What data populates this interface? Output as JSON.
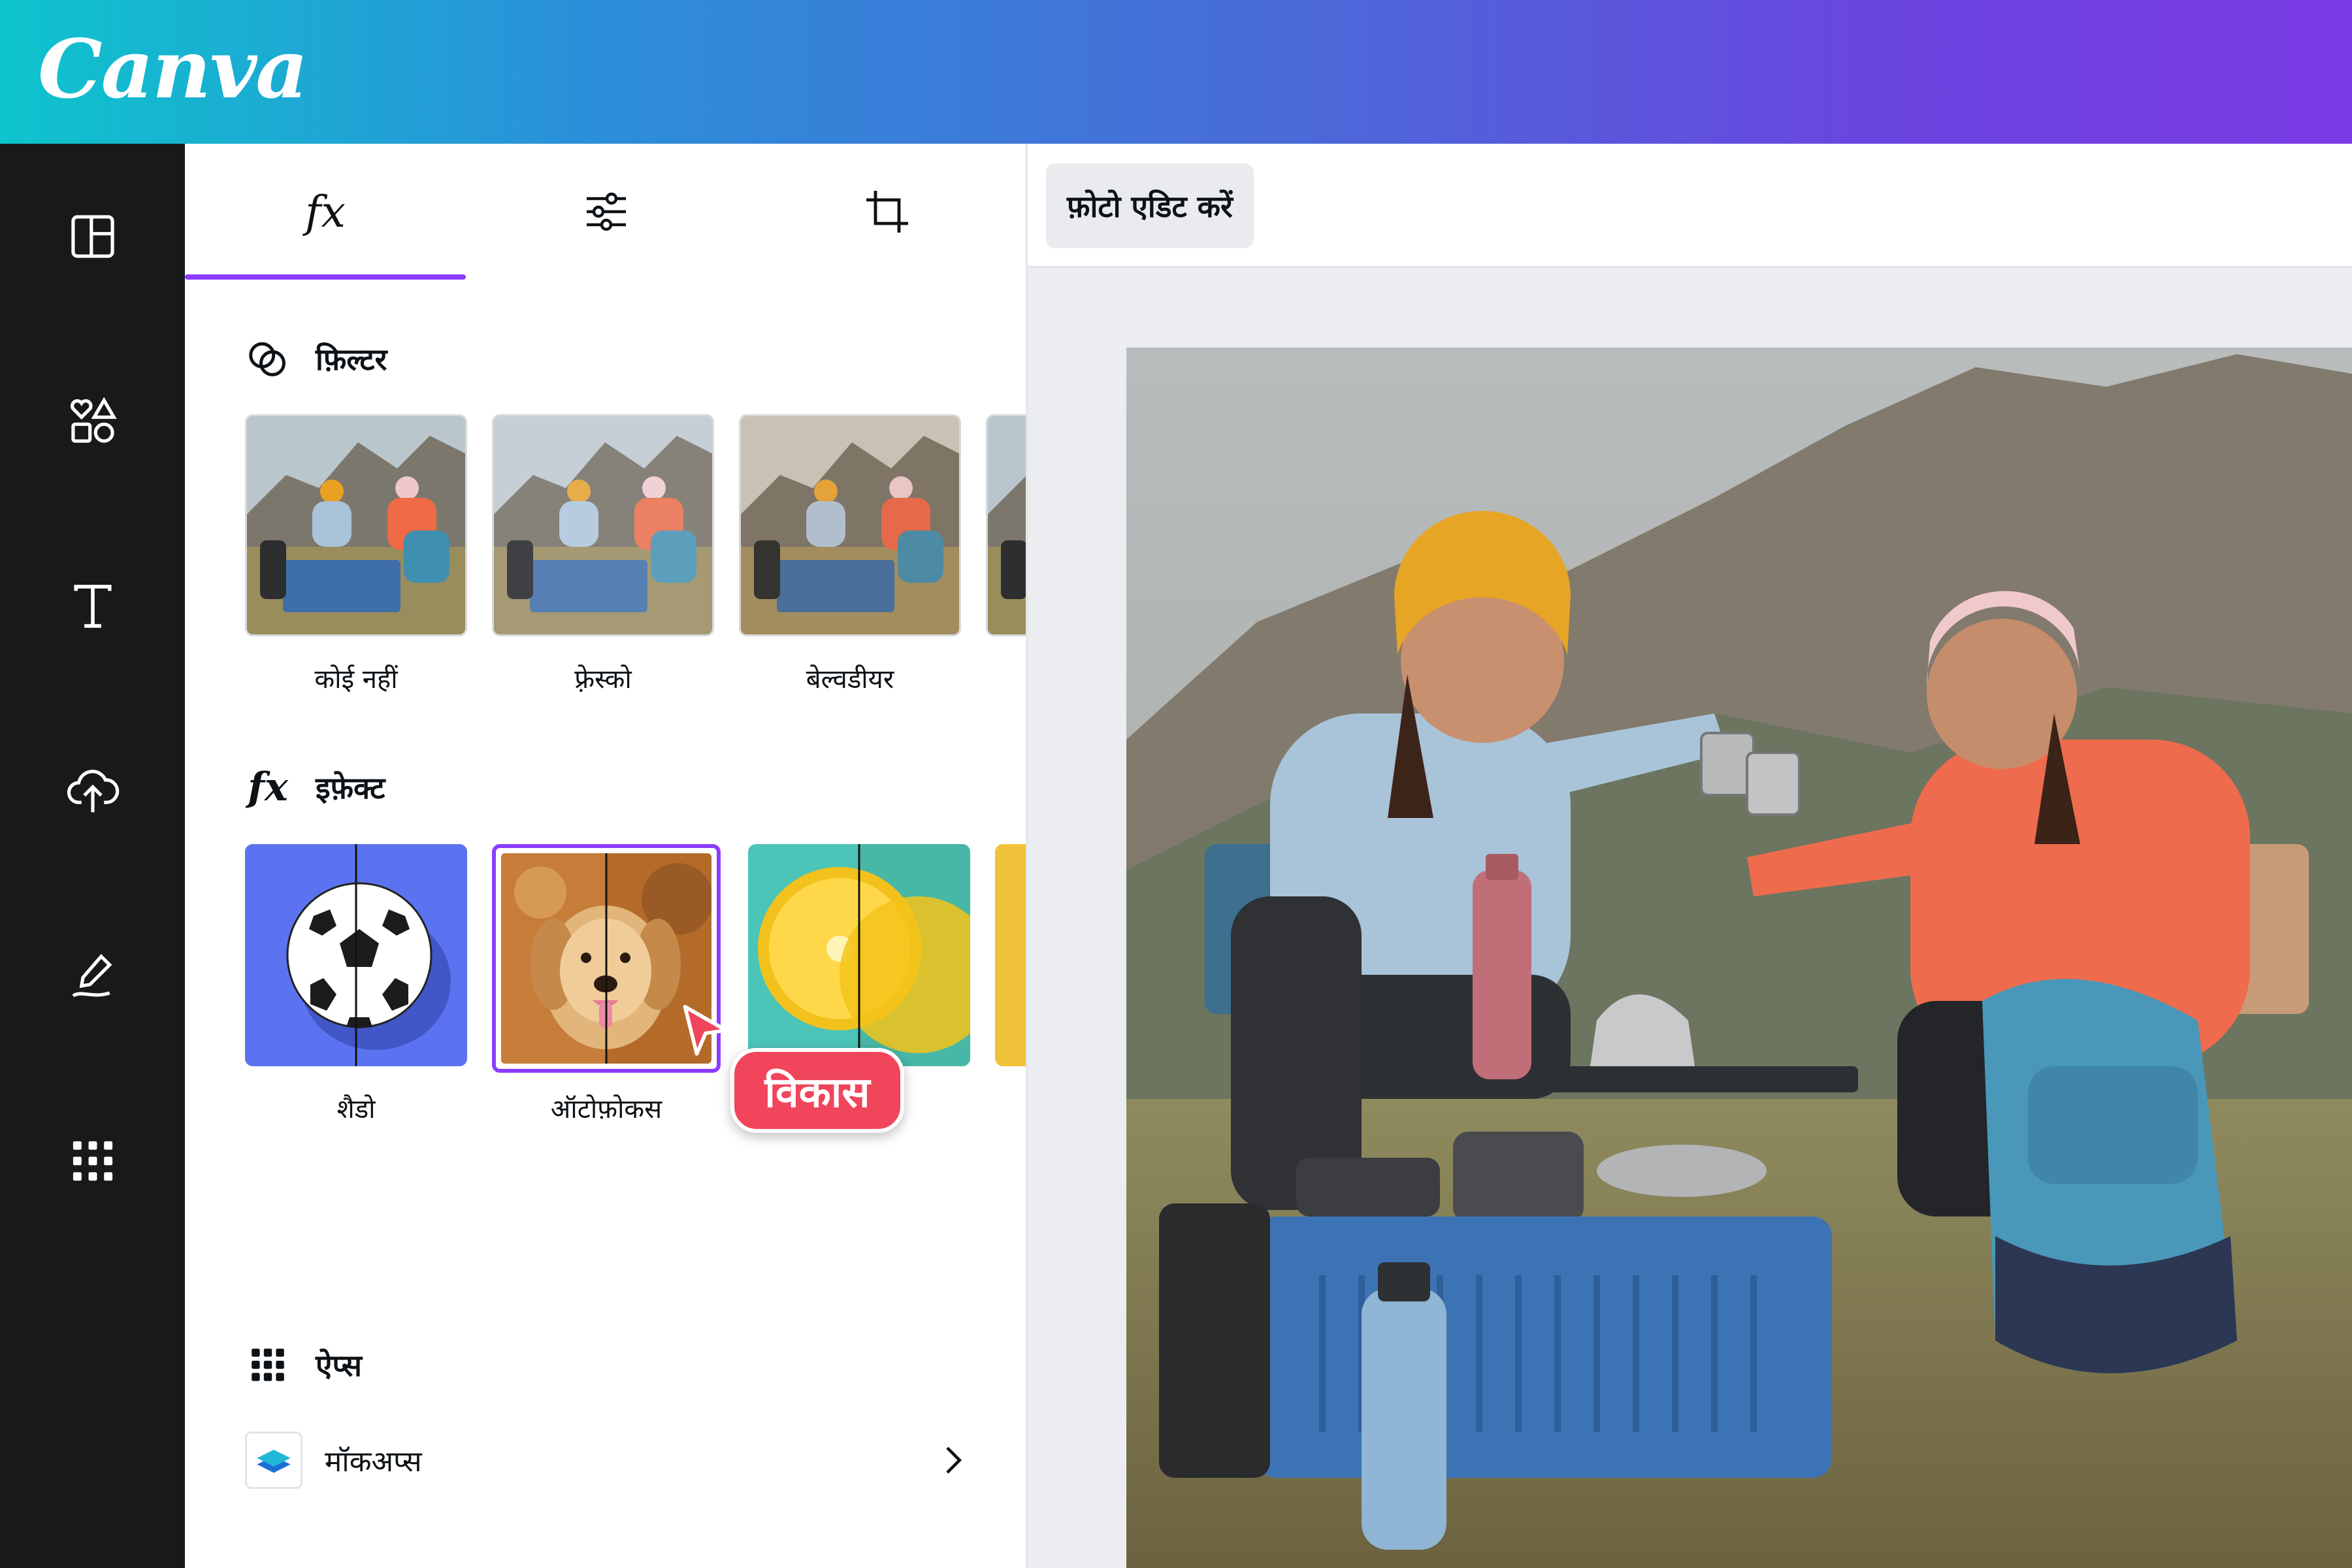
{
  "app": {
    "logo_text": "Canva",
    "brand_color": "#8b3dff",
    "rail_color": "#18191b"
  },
  "rail": {
    "items": [
      {
        "name": "design-icon"
      },
      {
        "name": "elements-icon"
      },
      {
        "name": "text-icon"
      },
      {
        "name": "uploads-icon"
      },
      {
        "name": "draw-icon"
      },
      {
        "name": "apps-icon"
      }
    ]
  },
  "panel": {
    "tabs": [
      {
        "label": "fx",
        "icon": "effects-icon",
        "active": true
      },
      {
        "label": "",
        "icon": "adjust-sliders-icon",
        "active": false
      },
      {
        "label": "",
        "icon": "crop-icon",
        "active": false
      }
    ],
    "filters": {
      "title": "फ़िल्टर",
      "items": [
        {
          "label": "कोई नहीं"
        },
        {
          "label": "फ़्रेस्को"
        },
        {
          "label": "बेल्वडीयर"
        }
      ]
    },
    "effects": {
      "title": "इफ़ेक्ट",
      "items": [
        {
          "label": "शैडो",
          "icon": "soccer-ball-icon"
        },
        {
          "label": "ऑटोफ़ोकस",
          "icon": "dog-icon",
          "selected": true
        },
        {
          "label": "",
          "icon": "lemon-icon"
        }
      ],
      "tooltip": "विकास",
      "tooltip_color": "#f0455b"
    },
    "apps": {
      "title": "ऐप्स",
      "items": [
        {
          "label": "मॉकअप्स",
          "icon": "layers-icon"
        }
      ]
    }
  },
  "editor": {
    "edit_button": "फ़ोटो एडिट करें"
  }
}
